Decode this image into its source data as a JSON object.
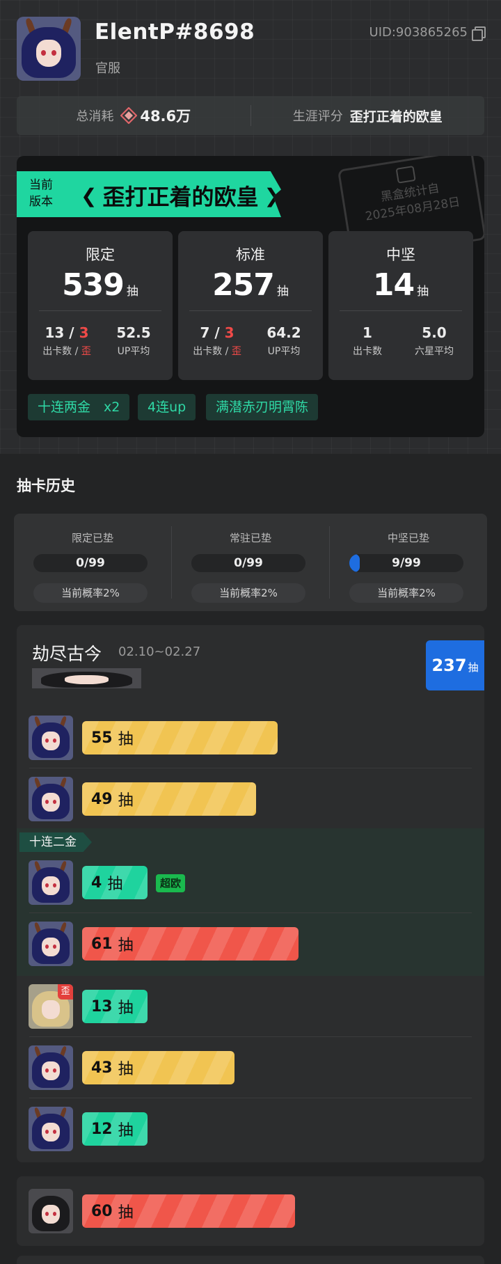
{
  "profile": {
    "username": "ElentP#8698",
    "server": "官服",
    "uid": "UID:903865265"
  },
  "stats": {
    "total_spend_label": "总消耗",
    "total_spend_value": "48.6万",
    "career_label": "生涯评分",
    "career_value": "歪打正着的欧皇"
  },
  "version": {
    "ribbon_label": "当前版本",
    "ribbon_title": "歪打正着的欧皇",
    "stamp_line1": "黑盒统计自",
    "stamp_line2": "2025年08月28日",
    "pools": [
      {
        "name": "限定",
        "count": "539",
        "unit": "抽",
        "stat1_a": "13",
        "stat1_slash": " / ",
        "stat1_b": "3",
        "stat1_label_a": "出卡数",
        "stat1_label_slash": " / ",
        "stat1_label_b": "歪",
        "stat2": "52.5",
        "stat2_label": "UP平均"
      },
      {
        "name": "标准",
        "count": "257",
        "unit": "抽",
        "stat1_a": "7",
        "stat1_slash": " / ",
        "stat1_b": "3",
        "stat1_label_a": "出卡数",
        "stat1_label_slash": " / ",
        "stat1_label_b": "歪",
        "stat2": "64.2",
        "stat2_label": "UP平均"
      },
      {
        "name": "中坚",
        "count": "14",
        "unit": "抽",
        "stat1_a": "1",
        "stat1_slash": "",
        "stat1_b": "",
        "stat1_label_a": "出卡数",
        "stat1_label_slash": "",
        "stat1_label_b": "",
        "stat2": "5.0",
        "stat2_label": "六星平均"
      }
    ],
    "tags": [
      "十连两金　x2",
      "4连up",
      "满潜赤刃明霄陈"
    ]
  },
  "history": {
    "title": "抽卡历史",
    "pity": [
      {
        "label": "限定已垫",
        "value": "0/99",
        "progress": 0,
        "rate": "当前概率2%"
      },
      {
        "label": "常驻已垫",
        "value": "0/99",
        "progress": 0,
        "rate": "当前概率2%"
      },
      {
        "label": "中坚已垫",
        "value": "9/99",
        "progress": 0.09,
        "rate": "当前概率2%"
      }
    ]
  },
  "banner": {
    "name": "劫尽古今",
    "dates": "02.10~02.27",
    "total": "237",
    "total_unit": "抽",
    "group_label": "十连二金",
    "ou_badge": "超欧",
    "wai_badge": "歪",
    "pulls": [
      {
        "count": "55",
        "unit": "抽",
        "color": "#f1c452"
      },
      {
        "count": "49",
        "unit": "抽",
        "color": "#f1c452"
      },
      {
        "count": "4",
        "unit": "抽",
        "color": "#1fd39e"
      },
      {
        "count": "61",
        "unit": "抽",
        "color": "#f0564a"
      },
      {
        "count": "13",
        "unit": "抽",
        "color": "#1fd39e"
      },
      {
        "count": "43",
        "unit": "抽",
        "color": "#f1c452"
      },
      {
        "count": "12",
        "unit": "抽",
        "color": "#1fd39e"
      }
    ]
  },
  "banner2": {
    "pulls": [
      {
        "count": "60",
        "unit": "抽",
        "color": "#f0564a"
      }
    ]
  },
  "colors": {
    "accent_green": "#1fd6a0",
    "accent_blue": "#1e6de0",
    "red": "#f04a48",
    "yellow": "#f1c452"
  }
}
